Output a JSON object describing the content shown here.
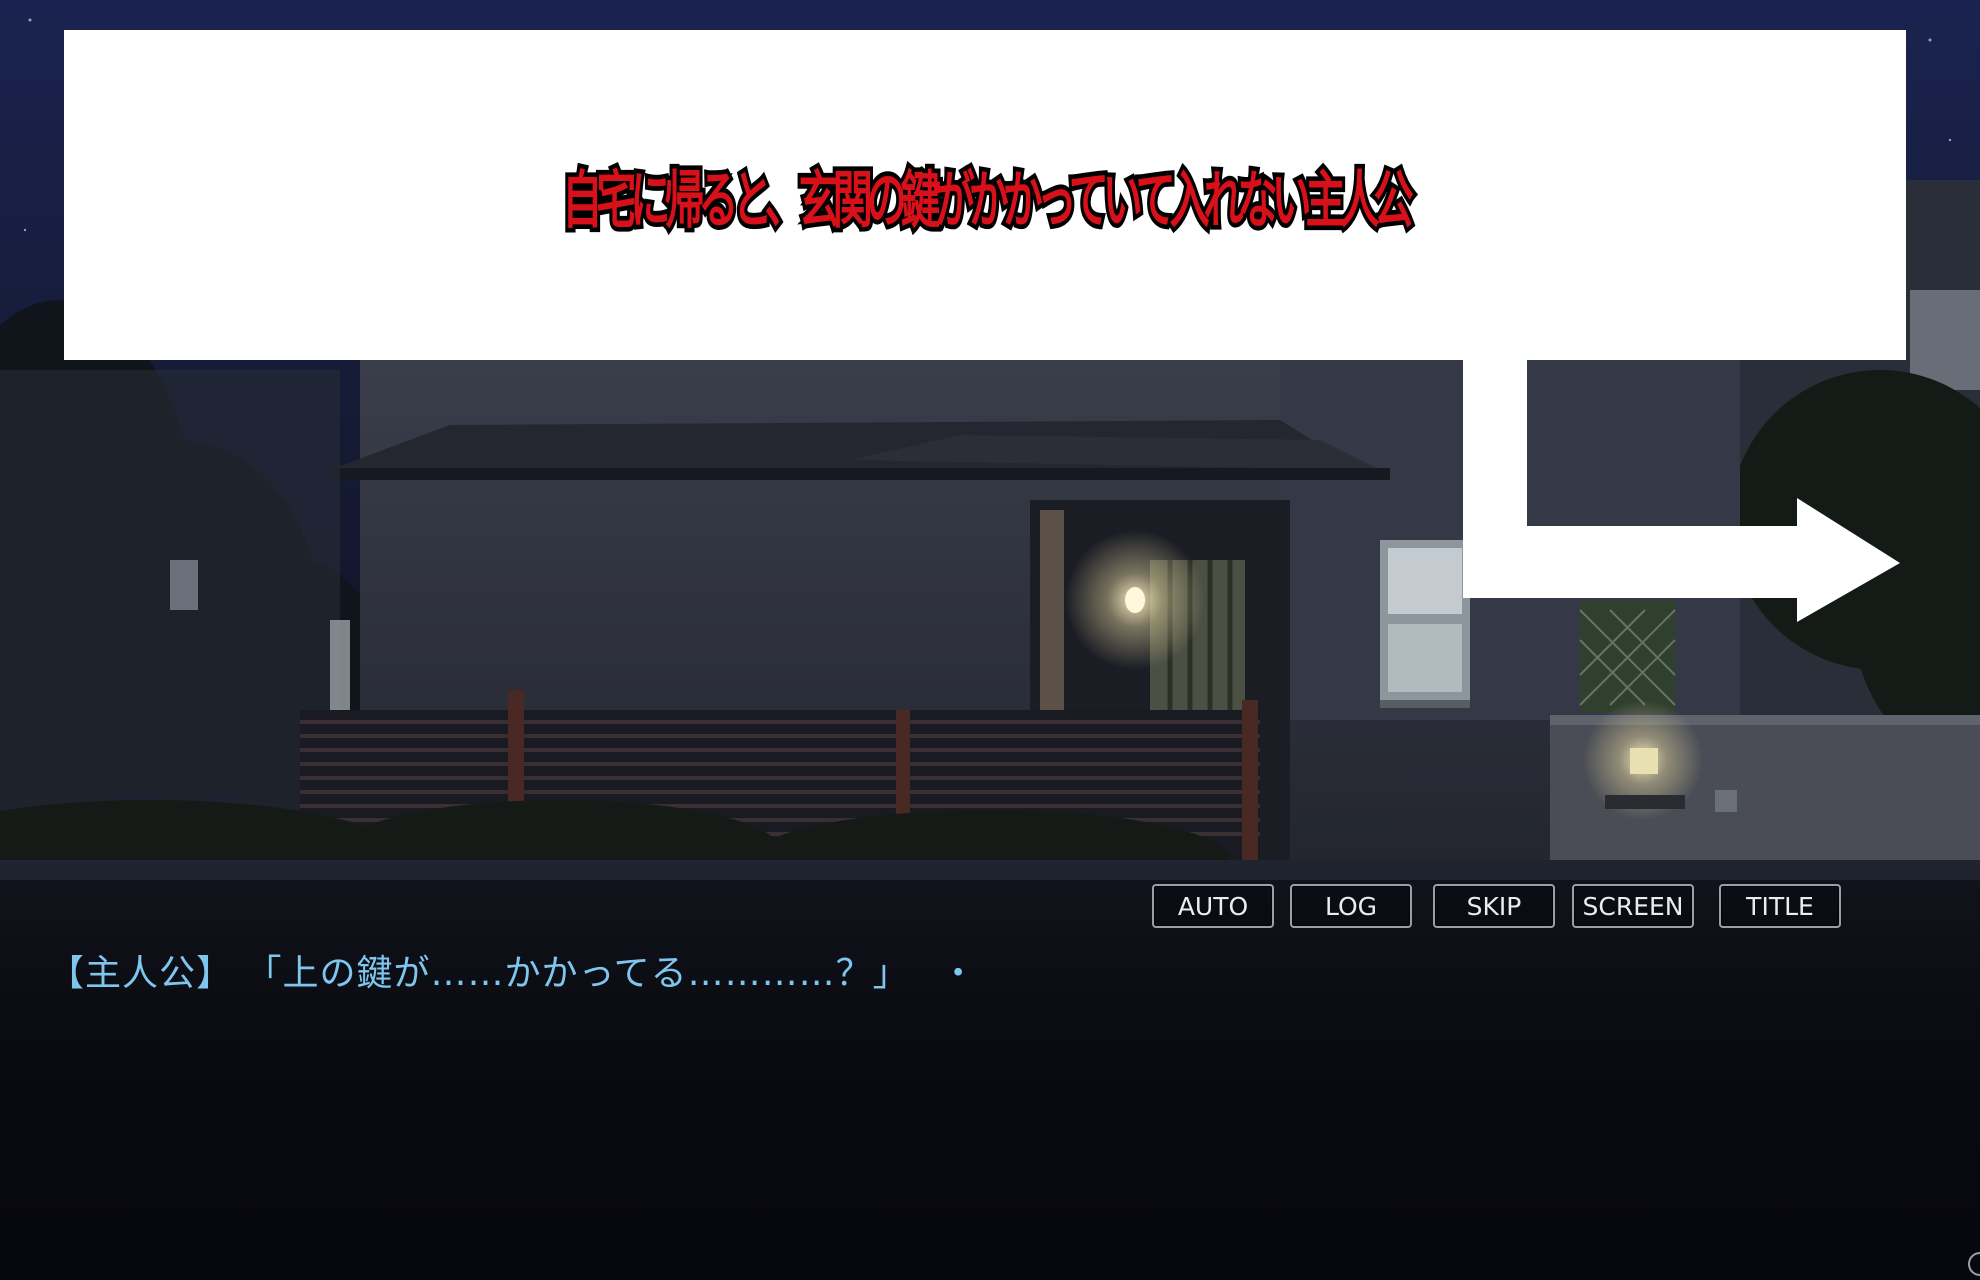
{
  "caption": {
    "text": "自宅に帰ると、玄関の鍵がかかっていて入れない主人公",
    "text_color": "#d8101a",
    "outline_color": "#000000",
    "box_color": "#ffffff"
  },
  "annotation_arrow": {
    "color": "#ffffff",
    "direction": "right"
  },
  "menu": {
    "auto": "AUTO",
    "log": "LOG",
    "skip": "SKIP",
    "screen": "SCREEN",
    "title": "TITLE"
  },
  "dialogue": {
    "speaker": "【主人公】",
    "text": "「上の鍵が……かかってる…………？」",
    "cursor": "・",
    "color": "#7fc6ef"
  },
  "scene": {
    "description_icon": "night-house-background"
  }
}
